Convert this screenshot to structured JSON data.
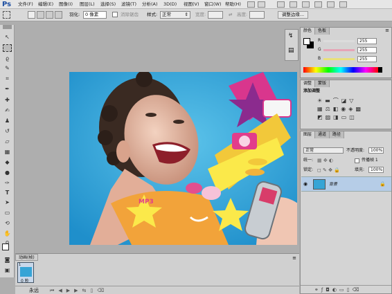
{
  "app_logo": "Ps",
  "menu": [
    "文件(F)",
    "编辑(E)",
    "图像(I)",
    "图层(L)",
    "选择(S)",
    "滤镜(T)",
    "分析(A)",
    "3D(D)",
    "视图(V)",
    "窗口(W)",
    "帮助(H)"
  ],
  "options": {
    "feather_label": "羽化:",
    "feather_value": "0 像素",
    "antialias_label": "消除锯齿",
    "style_label": "样式:",
    "style_value": "正常",
    "width_label": "宽度:",
    "height_label": "高度:",
    "refine_edge": "调整边缘..."
  },
  "color_panel": {
    "tabs": [
      "颜色",
      "色板"
    ],
    "channels": [
      {
        "name": "R",
        "value": "255",
        "color": "#e0b0b0"
      },
      {
        "name": "G",
        "value": "255",
        "color": "#b0e0b0"
      },
      {
        "name": "B",
        "value": "255",
        "color": "#b0b0e0"
      }
    ]
  },
  "adjustments_panel": {
    "tabs": [
      "调整",
      "蒙版"
    ],
    "title": "添加调整"
  },
  "layers_panel": {
    "tabs": [
      "图层",
      "通道",
      "路径"
    ],
    "blend_mode": "正常",
    "opacity_label": "不透明度:",
    "opacity_value": "100%",
    "unify_label": "统一:",
    "propagate_label": "传播帧 1",
    "lock_label": "锁定:",
    "fill_label": "填充:",
    "fill_value": "100%",
    "layer_name": "背景"
  },
  "timeline": {
    "tab": "动画(帧)",
    "frame_number": "1",
    "frame_delay": "0 秒",
    "loop_value": "永远"
  },
  "colors": {
    "menubar": "#e6e6e6",
    "photo_bg": "#33a7dc",
    "layer_selected": "#b6cde7"
  }
}
